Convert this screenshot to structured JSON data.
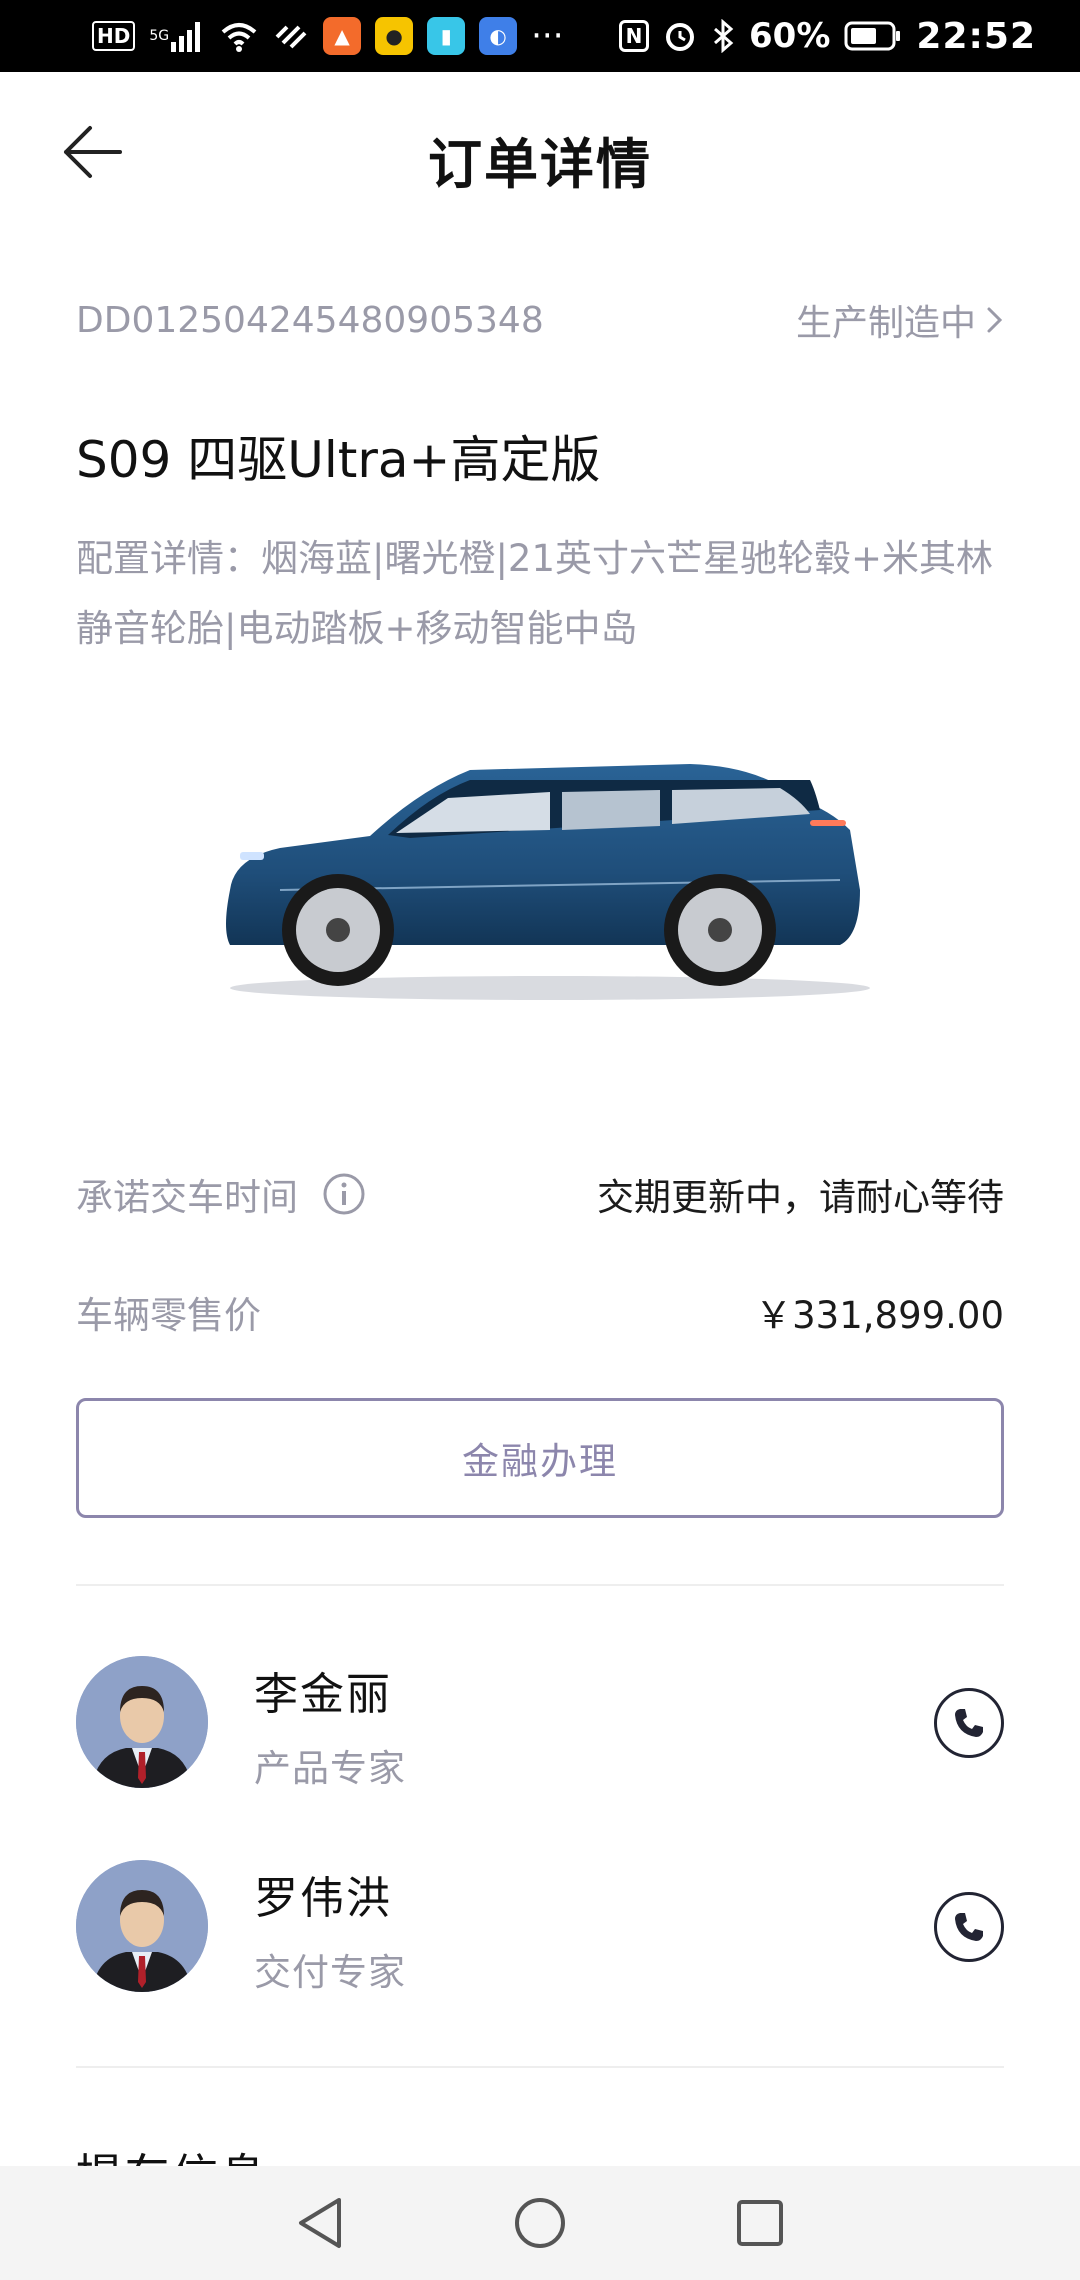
{
  "status_bar": {
    "hd": "HD",
    "network": "5G",
    "more": "···",
    "battery": "60%",
    "time": "22:52"
  },
  "header": {
    "title": "订单详情"
  },
  "order": {
    "number": "DD012504245480905348",
    "status": "生产制造中"
  },
  "vehicle": {
    "model": "S09 四驱Ultra+高定版",
    "config": "配置详情：烟海蓝|曙光橙|21英寸六芒星驰轮毂+米其林静音轮胎|电动踏板+移动智能中岛",
    "color_hex": "#1f4e7a"
  },
  "delivery": {
    "label": "承诺交车时间",
    "value": "交期更新中，请耐心等待"
  },
  "price": {
    "label": "车辆零售价",
    "value": "￥331,899.00"
  },
  "finance_button": "金融办理",
  "contacts": [
    {
      "name": "李金丽",
      "role": "产品专家"
    },
    {
      "name": "罗伟洪",
      "role": "交付专家"
    }
  ],
  "next_section_title": "提车信息",
  "colors": {
    "accent": "#8c86ac",
    "muted_text": "#9a9aa8",
    "avatar_bg": "#8ea1c8"
  }
}
